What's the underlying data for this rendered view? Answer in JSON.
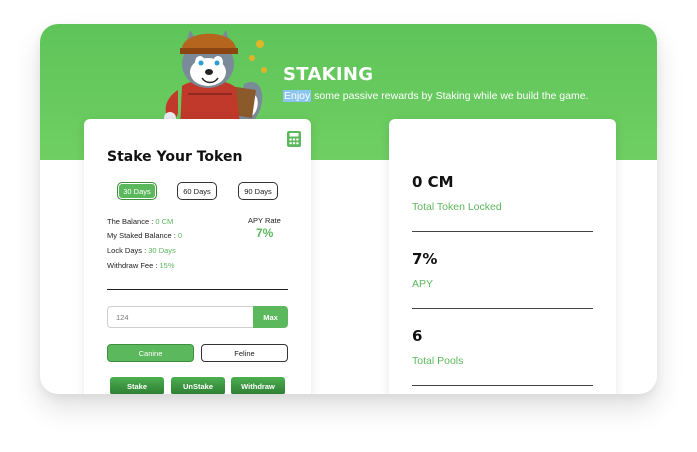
{
  "hero": {
    "title": "STAKING",
    "subtitle_highlight": "Enjoy",
    "subtitle_rest": " some passive rewards by Staking while we build the game."
  },
  "stake_card": {
    "title": "Stake Your Token",
    "periods": [
      "30 Days",
      "60 Days",
      "90 Days"
    ],
    "active_period": "30 Days",
    "balance_label": "The Balance : ",
    "balance_value": "0 CM",
    "staked_label": "My Staked Balance : ",
    "staked_value": "0",
    "lock_label": "Lock Days : ",
    "lock_value": "30 Days",
    "fee_label": "Withdraw Fee : ",
    "fee_value": "15%",
    "apy_label": "APY Rate",
    "apy_value": "7%",
    "amount_placeholder": "124",
    "max_label": "Max",
    "types": [
      "Canine",
      "Feline"
    ],
    "active_type": "Canine",
    "actions": [
      "Stake",
      "UnStake",
      "Withdraw"
    ]
  },
  "stats": [
    {
      "value": "0 CM",
      "label": "Total Token Locked"
    },
    {
      "value": "7%",
      "label": "APY"
    },
    {
      "value": "6",
      "label": "Total Pools"
    }
  ],
  "colors": {
    "brand_green": "#5cb85c",
    "banner_green": "#66c95c",
    "text_dark": "#111111"
  },
  "icons": {
    "calculator": "calculator-icon",
    "mascot": "husky-mascot"
  }
}
